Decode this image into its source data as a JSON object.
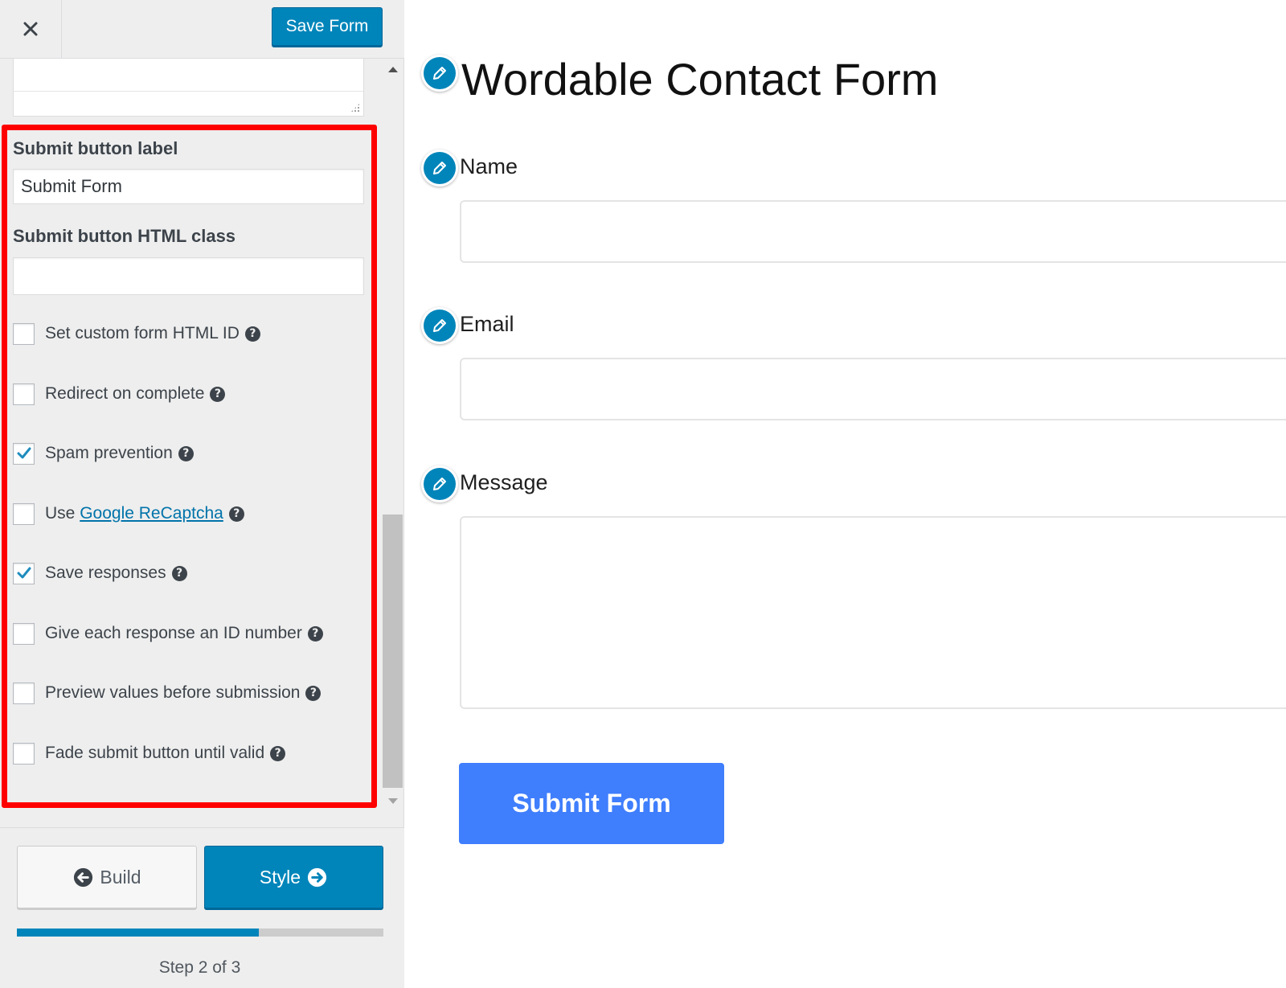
{
  "topbar": {
    "close_icon": "close-icon",
    "save_label": "Save Form"
  },
  "settings": {
    "submit_label": {
      "label": "Submit button label",
      "value": "Submit Form"
    },
    "submit_class": {
      "label": "Submit button HTML class",
      "value": ""
    },
    "options": [
      {
        "label": "Set custom form HTML ID",
        "checked": false,
        "link_text": ""
      },
      {
        "label": "Redirect on complete",
        "checked": false,
        "link_text": ""
      },
      {
        "label": "Spam prevention",
        "checked": true,
        "link_text": ""
      },
      {
        "label": "Use",
        "checked": false,
        "link_text": "Google ReCaptcha"
      },
      {
        "label": "Save responses",
        "checked": true,
        "link_text": ""
      },
      {
        "label": "Give each response an ID number",
        "checked": false,
        "link_text": ""
      },
      {
        "label": "Preview values before submission",
        "checked": false,
        "link_text": ""
      },
      {
        "label": "Fade submit button until valid",
        "checked": false,
        "link_text": ""
      }
    ],
    "help_glyph": "?",
    "highlight_color": "#ff0000"
  },
  "footer": {
    "build_label": "Build",
    "style_label": "Style",
    "progress": 0.66,
    "step_text": "Step 2 of 3"
  },
  "preview": {
    "title": "Wordable Contact Form",
    "fields": [
      {
        "label": "Name"
      },
      {
        "label": "Email"
      },
      {
        "label": "Message"
      }
    ],
    "submit_label": "Submit Form",
    "submit_color": "#3f7efd",
    "accent_color": "#0085ba"
  }
}
